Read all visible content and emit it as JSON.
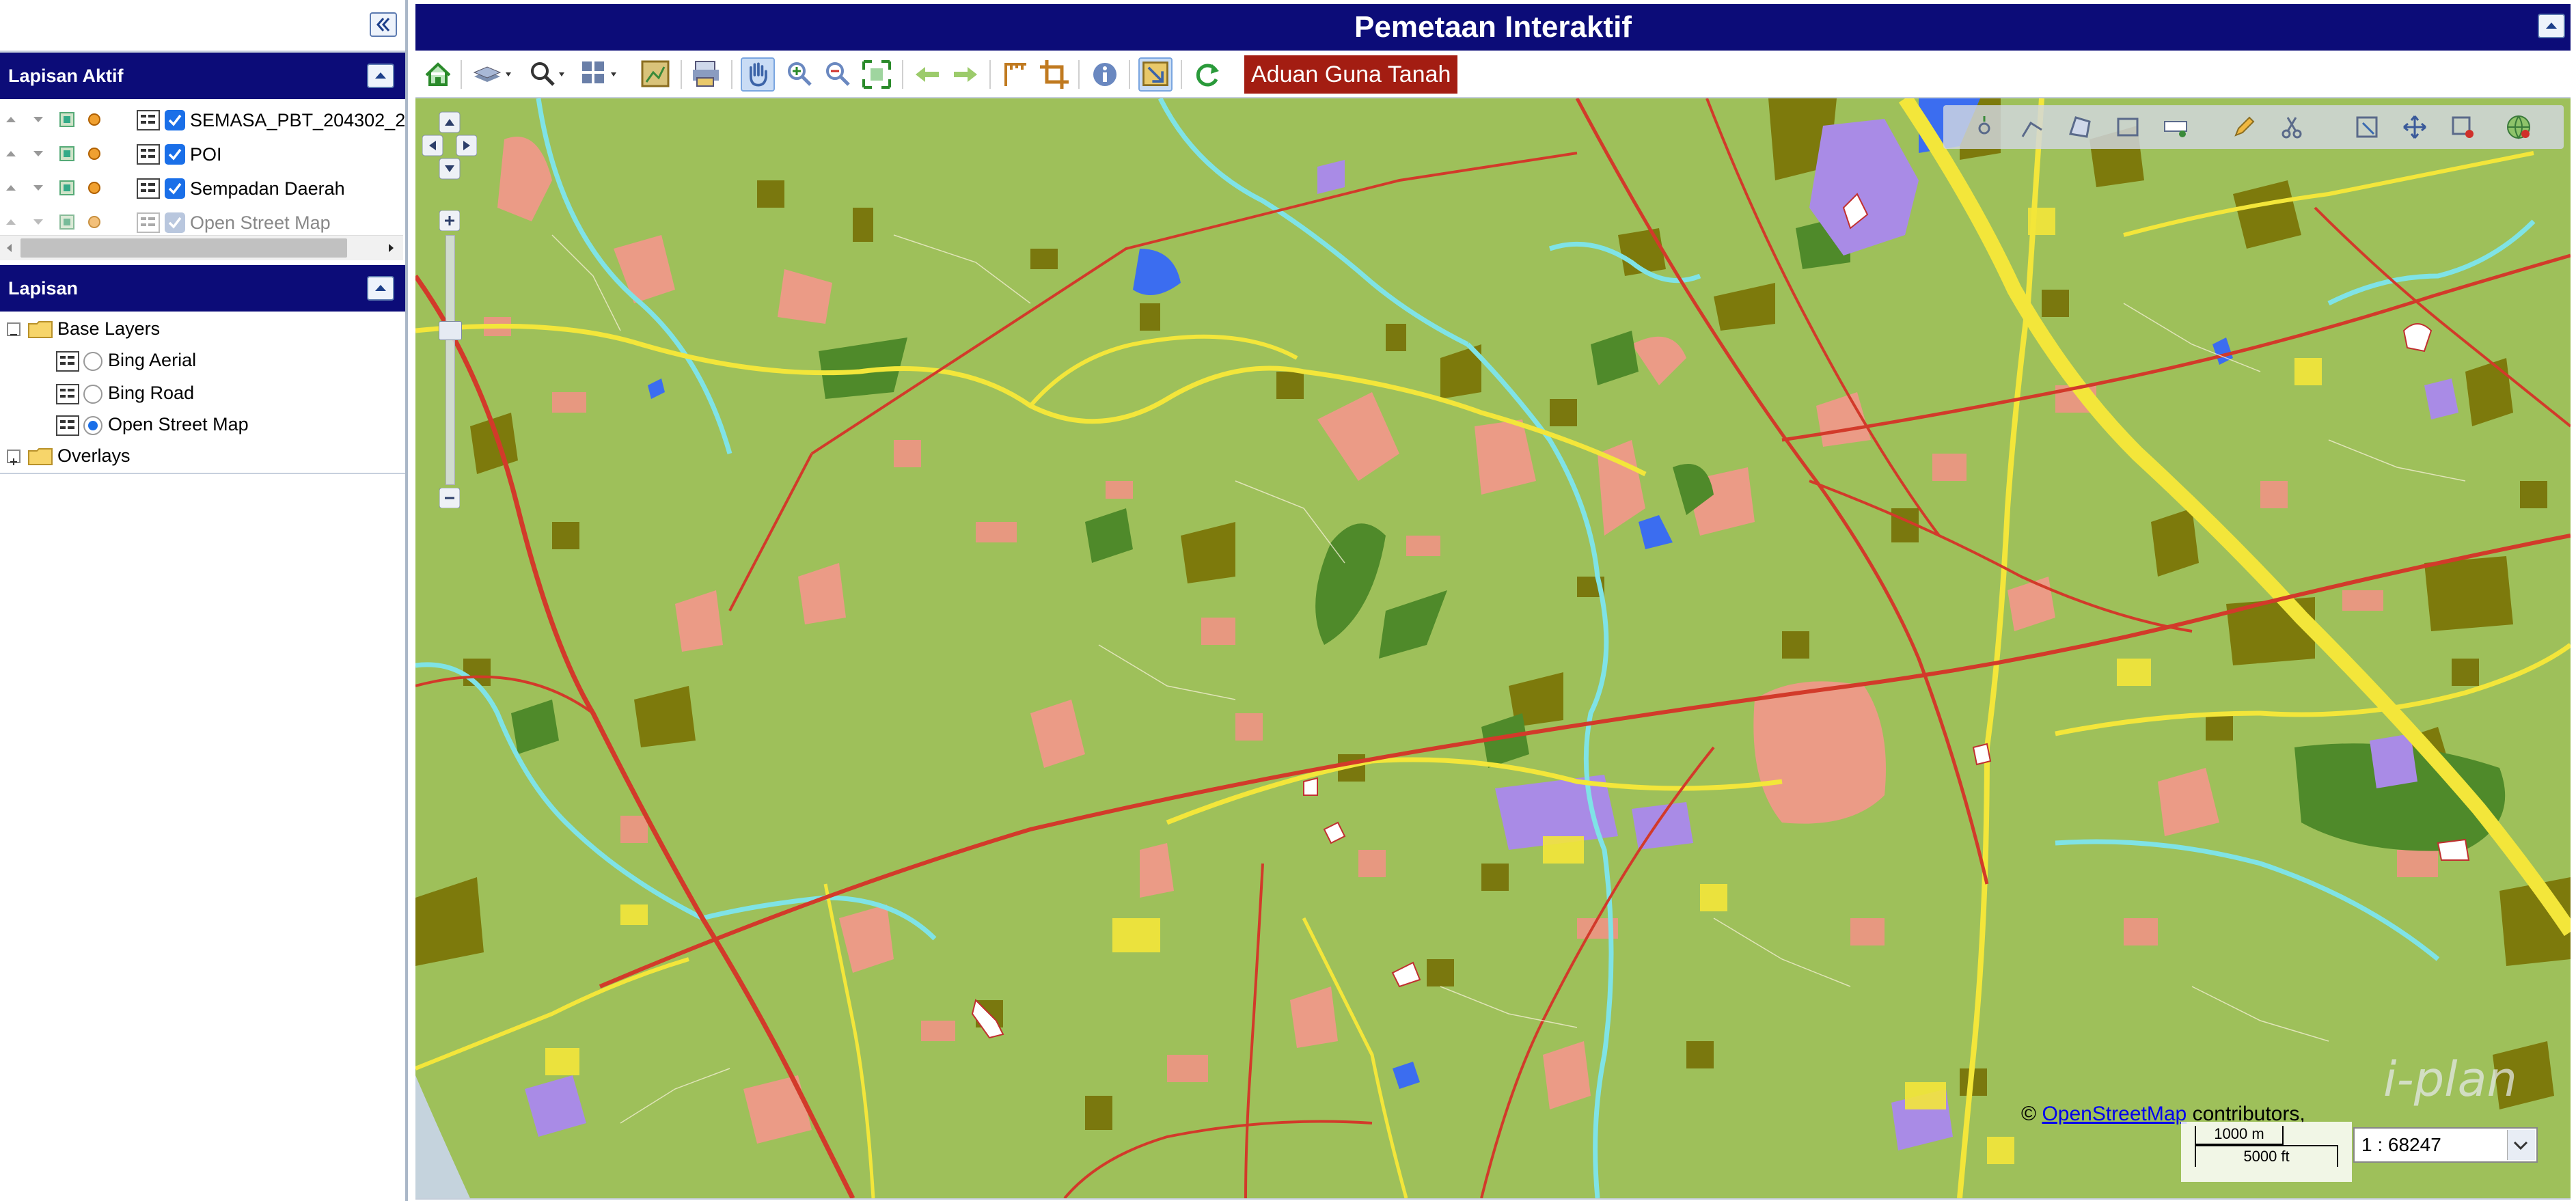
{
  "left_panel": {
    "active_layers_title": "Lapisan Aktif",
    "active_layers": [
      {
        "label": "SEMASA_PBT_204302_2",
        "checked": true,
        "dim": false
      },
      {
        "label": "POI",
        "checked": true,
        "dim": false
      },
      {
        "label": "Sempadan Daerah",
        "checked": true,
        "dim": false
      },
      {
        "label": "Open Street Map",
        "checked": true,
        "dim": true
      }
    ],
    "layers_title": "Lapisan",
    "tree": {
      "base_layers": "Base Layers",
      "bing_aerial": "Bing Aerial",
      "bing_road": "Bing Road",
      "open_street_map": "Open Street Map",
      "overlays": "Overlays",
      "selected_base": "Open Street Map"
    }
  },
  "header": {
    "title": "Pemetaan Interaktif"
  },
  "toolbar": {
    "aduan_label": "Aduan Guna Tanah",
    "tools": [
      "home-icon",
      "layers-icon",
      "zoom-icon",
      "grid-icon",
      "map-icon",
      "print-icon",
      "pan-hand-icon",
      "zoom-in-icon",
      "zoom-out-icon",
      "full-extent-icon",
      "back-arrow-icon",
      "forward-arrow-icon",
      "measure-icon",
      "crop-icon",
      "info-icon",
      "select-icon",
      "refresh-icon"
    ]
  },
  "map": {
    "attribution_prefix": "©",
    "attribution_link": "OpenStreetMap",
    "attribution_suffix": "contributors,",
    "scale_metric": "1000 m",
    "scale_imperial": "5000 ft",
    "scale_ratio": "1 : 68247",
    "watermark": "i-plan"
  },
  "colors": {
    "header_bg": "#0c0c78",
    "aduan_bg": "#a31d12",
    "map_green": "#9ec05a",
    "road_red": "#d23a2a",
    "road_yellow": "#f3e63a",
    "river": "#7fe3e6",
    "residential_pink": "#eb9b86",
    "dark_olive": "#7d7a0c",
    "forest": "#4f8a2a",
    "commercial_purple": "#a98be6",
    "water_blue": "#3b6df0"
  }
}
